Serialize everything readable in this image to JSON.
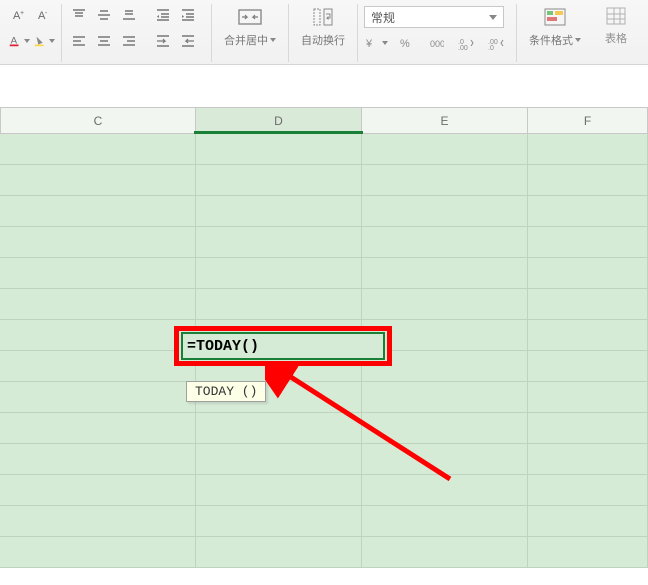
{
  "ribbon": {
    "merge_label": "合并居中",
    "wrap_label": "自动换行",
    "format_select": "常规",
    "cond_format_label": "条件格式",
    "table_format_label": "表格"
  },
  "columns": {
    "c": "C",
    "d": "D",
    "e": "E",
    "f": "F"
  },
  "editing": {
    "formula": "=TODAY()",
    "tooltip": "TODAY ()"
  }
}
